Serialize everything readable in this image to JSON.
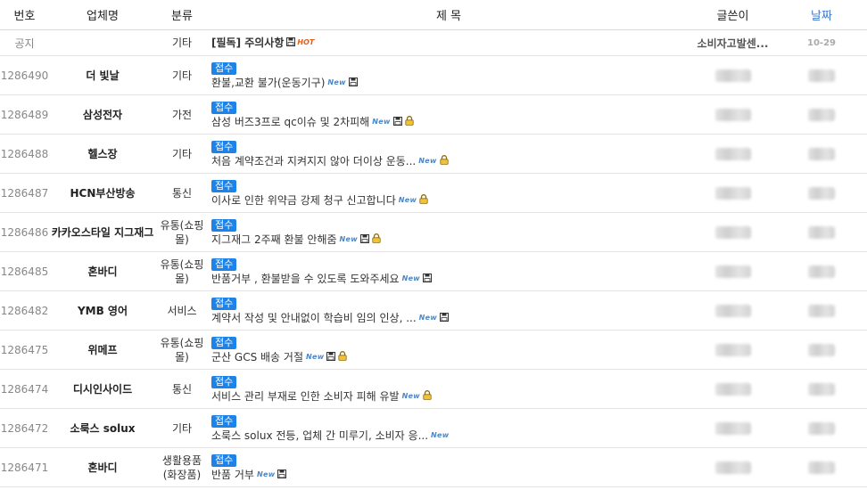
{
  "header": {
    "num": "번호",
    "company": "업체명",
    "category": "분류",
    "title": "제 목",
    "author": "글쓴이",
    "date": "날짜"
  },
  "notice": {
    "num": "공지",
    "category": "기타",
    "title": "[필독] 주의사항",
    "author": "소비자고발센...",
    "date": "10-29"
  },
  "badge_label": "접수",
  "new_label": "New",
  "hot_label": "HOT",
  "rows": [
    {
      "num": "1286490",
      "company": "더 빛날",
      "category": "기타",
      "title": "환불,교환 불가(운동기구)",
      "file": true,
      "lock": false
    },
    {
      "num": "1286489",
      "company": "삼성전자",
      "category": "가전",
      "title": "삼성 버즈3프로 qc이슈 및 2차피해",
      "file": true,
      "lock": true
    },
    {
      "num": "1286488",
      "company": "헬스장",
      "category": "기타",
      "title": "처음 계약조건과 지켜지지 않아 더이상 운동...",
      "file": false,
      "lock": true
    },
    {
      "num": "1286487",
      "company": "HCN부산방송",
      "category": "통신",
      "title": "이사로 인한 위약금 강제 청구 신고합니다",
      "file": false,
      "lock": true
    },
    {
      "num": "1286486",
      "company": "카카오스타일 지그재그",
      "category": "유통(쇼핑몰)",
      "title": "지그재그 2주째 환불 안해줌",
      "file": true,
      "lock": true
    },
    {
      "num": "1286485",
      "company": "혼바디",
      "category": "유통(쇼핑몰)",
      "title": "반품거부 , 환불받을 수 있도록 도와주세요",
      "file": true,
      "lock": false
    },
    {
      "num": "1286482",
      "company": "YMB 영어",
      "category": "서비스",
      "title": "계약서 작성 및 안내없이 학습비 임의 인상, ...",
      "file": true,
      "lock": false
    },
    {
      "num": "1286475",
      "company": "위메프",
      "category": "유통(쇼핑몰)",
      "title": "군산 GCS 배송 거절",
      "file": true,
      "lock": true
    },
    {
      "num": "1286474",
      "company": "디시인사이드",
      "category": "통신",
      "title": "서비스 관리 부재로 인한 소비자 피해 유발",
      "file": false,
      "lock": true
    },
    {
      "num": "1286472",
      "company": "소룩스 solux",
      "category": "기타",
      "title": "소룩스 solux 전등, 업체 간 미루기, 소비자 응...",
      "file": false,
      "lock": false
    },
    {
      "num": "1286471",
      "company": "혼바디",
      "category": "생활용품(화장품)",
      "title": "반품 거부",
      "file": true,
      "lock": false
    }
  ]
}
